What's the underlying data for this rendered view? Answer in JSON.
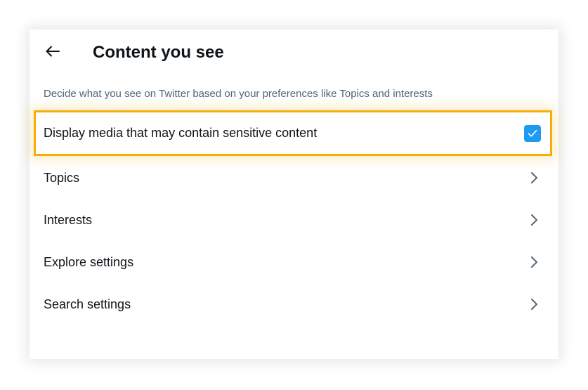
{
  "header": {
    "title": "Content you see",
    "back_icon": "arrow-left-icon"
  },
  "description": "Decide what you see on Twitter based on your preferences like Topics and interests",
  "sensitive_setting": {
    "label": "Display media that may contain sensitive content",
    "checked": true,
    "check_color": "#1d9bf0",
    "highlight_color": "#f5ad0a"
  },
  "menu": {
    "items": [
      {
        "label": "Topics",
        "icon": "chevron-right-icon"
      },
      {
        "label": "Interests",
        "icon": "chevron-right-icon"
      },
      {
        "label": "Explore settings",
        "icon": "chevron-right-icon"
      },
      {
        "label": "Search settings",
        "icon": "chevron-right-icon"
      }
    ]
  },
  "colors": {
    "text_primary": "#0f1419",
    "text_secondary": "#536471"
  }
}
